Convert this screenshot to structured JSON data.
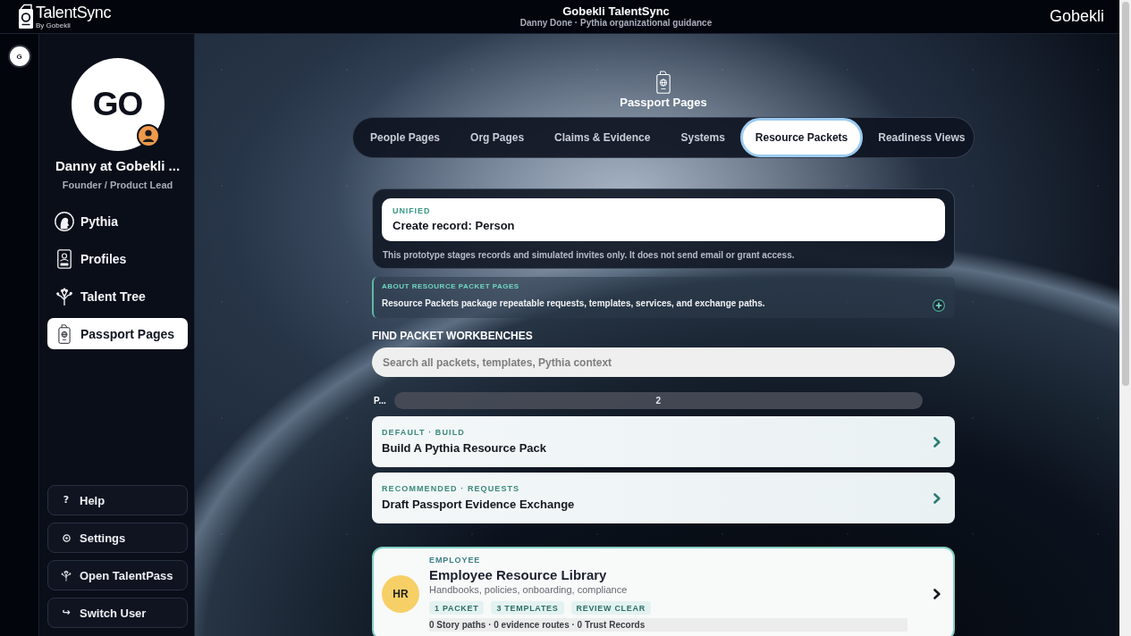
{
  "top_bar": {
    "logo": {
      "name": "TalentSync",
      "byline": "By Gobekli"
    },
    "title": "Gobekli TalentSync",
    "subtitle": "Danny Done · Pythia organizational guidance",
    "org": "Gobekli"
  },
  "rail": {
    "avatar": "G"
  },
  "sidebar": {
    "avatar": "GO",
    "name": "Danny at Gobekli ...",
    "role": "Founder / Product Lead",
    "nav": [
      {
        "label": "Pythia",
        "selected": false
      },
      {
        "label": "Profiles",
        "selected": false
      },
      {
        "label": "Talent Tree",
        "selected": false
      },
      {
        "label": "Passport Pages",
        "selected": true
      }
    ],
    "footer": [
      {
        "label": "Help",
        "glyph": "?"
      },
      {
        "label": "Settings"
      },
      {
        "label": "Open TalentPass"
      },
      {
        "label": "Switch User",
        "glyph": "↪"
      }
    ]
  },
  "page": {
    "title": "Passport Pages",
    "tabs": [
      {
        "label": "People Pages",
        "selected": false
      },
      {
        "label": "Org Pages",
        "selected": false
      },
      {
        "label": "Claims & Evidence",
        "selected": false
      },
      {
        "label": "Systems",
        "selected": false
      },
      {
        "label": "Resource Packets",
        "selected": true
      },
      {
        "label": "Readiness Views",
        "selected": false
      }
    ]
  },
  "record_card": {
    "tag": "UNIFIED",
    "title": "Create record: Person",
    "note": "This prototype stages records and simulated invites only. It does not send email or grant access."
  },
  "about": {
    "title": "ABOUT RESOURCE PACKET PAGES",
    "text": "Resource Packets package repeatable requests, templates, services, and exchange paths.",
    "expanded": false
  },
  "finder": {
    "heading": "FIND PACKET WORKBENCHES",
    "search": {
      "placeholder": "Search all packets, templates, Pythia context"
    },
    "label": "P...",
    "count": "2"
  },
  "workbenches": [
    {
      "tag": "DEFAULT · BUILD",
      "title": "Build A Pythia Resource Pack"
    },
    {
      "tag": "RECOMMENDED · REQUESTS",
      "title": "Draft Passport Evidence Exchange"
    }
  ],
  "libraries": [
    {
      "initials": "HR",
      "category": "EMPLOYEE",
      "title": "Employee Resource Library",
      "description": "Handbooks, policies, onboarding, compliance",
      "tags": [
        "1 PACKET",
        "3 TEMPLATES",
        "REVIEW CLEAR"
      ],
      "stats": "0 Story paths · 0 evidence routes · 0 Trust Records"
    }
  ]
}
